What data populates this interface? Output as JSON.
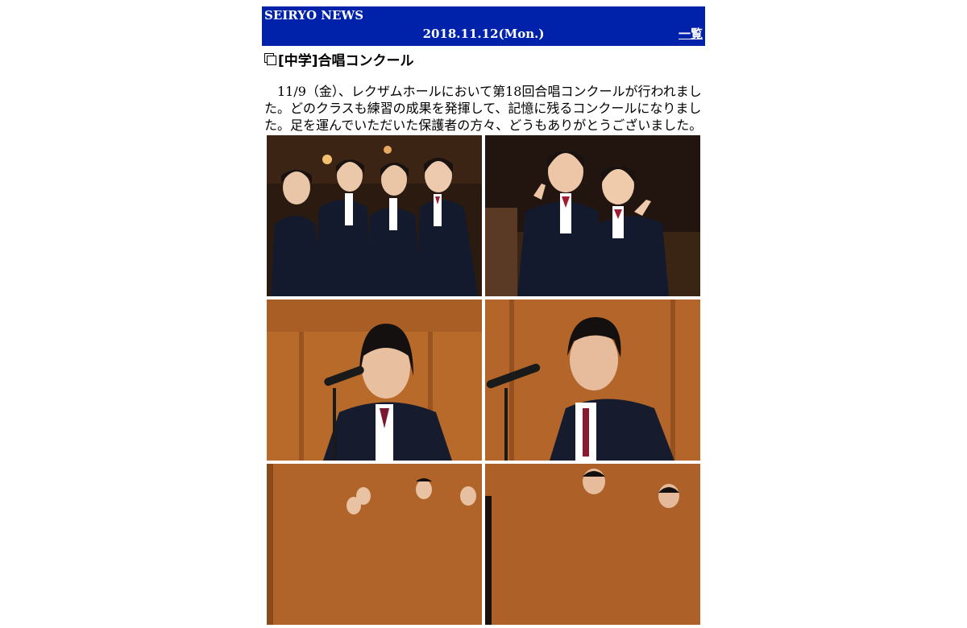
{
  "header": {
    "site_name": "SEIRYO NEWS",
    "date": "2018.11.12(Mon.)",
    "list_link": "一覧"
  },
  "article": {
    "title": "[中学]合唱コンクール",
    "body": "11/9（金）、レクザムホールにおいて第18回合唱コンクールが行われました。どのクラスも練習の成果を発揮して、記憶に残るコンクールになりました。足を運んでいただいた保護者の方々、どうもありがとうございました。"
  },
  "photos": [
    {
      "subject": "four-students-posing-photo"
    },
    {
      "subject": "two-students-peace-sign-photo"
    },
    {
      "subject": "girl-at-microphone-photo"
    },
    {
      "subject": "boy-at-microphone-photo"
    },
    {
      "subject": "choir-group-photo"
    },
    {
      "subject": "boys-choir-photo"
    }
  ],
  "colors": {
    "header_bg": "#0022aa",
    "header_text": "#ffffff"
  }
}
